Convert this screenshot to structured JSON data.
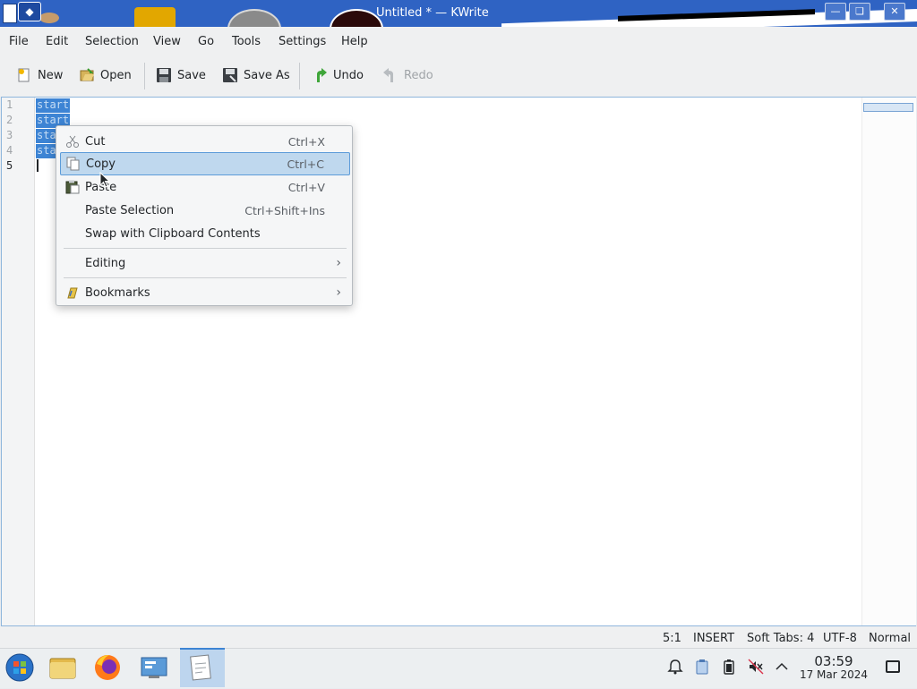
{
  "window": {
    "title": "Untitled * — KWrite"
  },
  "menubar": [
    "File",
    "Edit",
    "Selection",
    "View",
    "Go",
    "Tools",
    "Settings",
    "Help"
  ],
  "toolbar": {
    "new": "New",
    "open": "Open",
    "save": "Save",
    "save_as": "Save As",
    "undo": "Undo",
    "redo": "Redo"
  },
  "editor": {
    "line_numbers": [
      "1",
      "2",
      "3",
      "4",
      "5"
    ],
    "lines": [
      "start",
      "start",
      "start",
      "start",
      ""
    ]
  },
  "context_menu": {
    "items": [
      {
        "label": "Cut",
        "shortcut": "Ctrl+X"
      },
      {
        "label": "Copy",
        "shortcut": "Ctrl+C"
      },
      {
        "label": "Paste",
        "shortcut": "Ctrl+V"
      },
      {
        "label": "Paste Selection",
        "shortcut": "Ctrl+Shift+Ins"
      },
      {
        "label": "Swap with Clipboard Contents",
        "shortcut": ""
      },
      {
        "label": "Editing",
        "submenu": true
      },
      {
        "label": "Bookmarks",
        "submenu": true
      }
    ]
  },
  "statusbar": {
    "position": "5:1",
    "mode": "INSERT",
    "tabs": "Soft Tabs: 4",
    "encoding": "UTF-8",
    "highlight": "Normal"
  },
  "taskbar": {
    "time": "03:59",
    "date": "17 Mar 2024"
  },
  "colors": {
    "titlebar": "#2f63c3",
    "selection": "#3d84d4",
    "menu_highlight": "#bfd8ee"
  }
}
